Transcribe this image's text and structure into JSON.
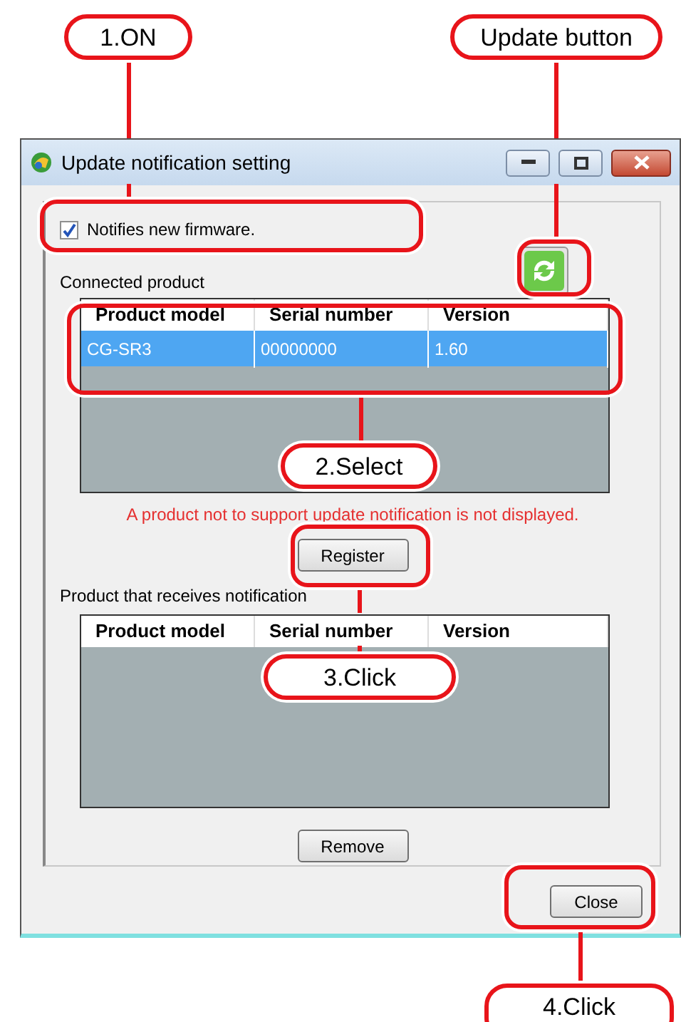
{
  "callouts": [
    {
      "label": "1.ON"
    },
    {
      "label": "Update button"
    },
    {
      "label": "2.Select"
    },
    {
      "label": "3.Click"
    },
    {
      "label": "4.Click"
    }
  ],
  "window": {
    "title": "Update notification setting"
  },
  "notify_checkbox": {
    "label": "Notifies new firmware.",
    "checked": true
  },
  "connected_product": {
    "label": "Connected product",
    "columns": [
      "Product model",
      "Serial number",
      "Version"
    ],
    "rows": [
      {
        "cells": [
          "CG-SR3",
          "00000000",
          "1.60"
        ],
        "selected": true
      }
    ]
  },
  "note": "A product not to support update notification is not displayed.",
  "register_button": "Register",
  "receiving_product": {
    "label": "Product that receives notification",
    "columns": [
      "Product model",
      "Serial number",
      "Version"
    ]
  },
  "remove_button": "Remove",
  "close_button": "Close"
}
